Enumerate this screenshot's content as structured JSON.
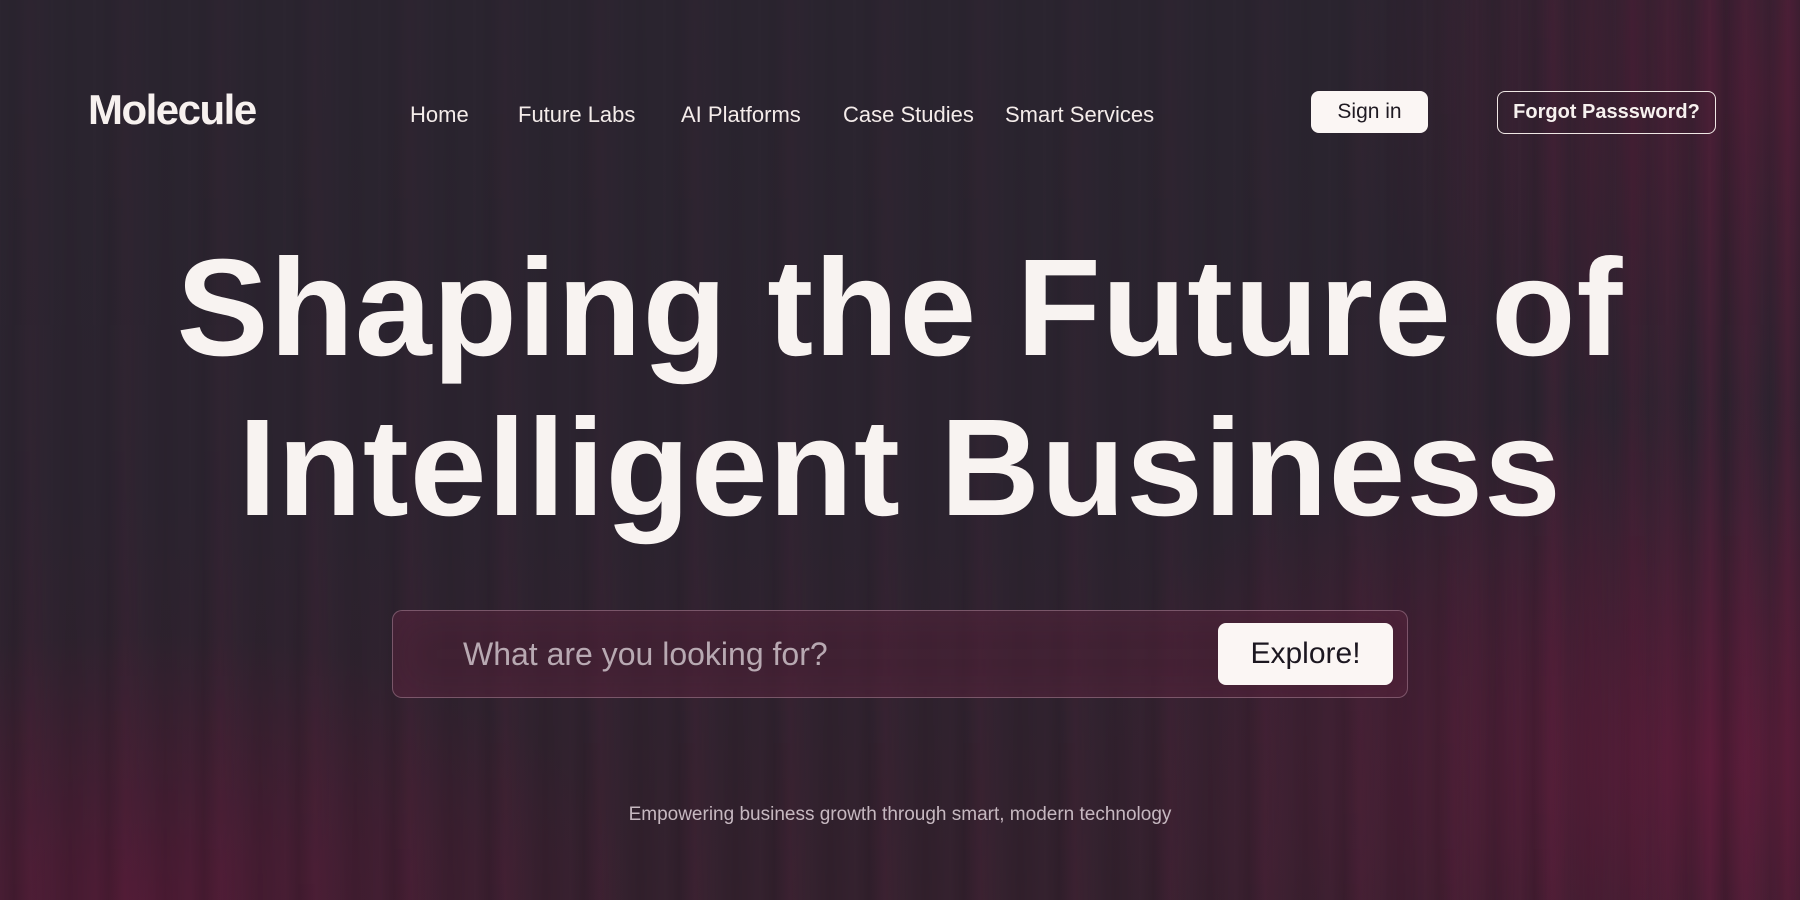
{
  "brand": {
    "name": "Molecule"
  },
  "nav": {
    "items": [
      {
        "label": "Home"
      },
      {
        "label": "Future Labs"
      },
      {
        "label": "AI Platforms"
      },
      {
        "label": "Case Studies"
      },
      {
        "label": "Smart Services"
      }
    ]
  },
  "auth": {
    "sign_in_label": "Sign in",
    "forgot_label": "Forgot Passsword?"
  },
  "hero": {
    "title_line1": "Shaping the Future of",
    "title_line2": "Intelligent Business"
  },
  "search": {
    "placeholder": "What are you looking for?",
    "value": "",
    "button_label": "Explore!"
  },
  "tagline": "Empowering business growth through smart, modern technology",
  "colors": {
    "background": "#2c2430",
    "accent_glow": "#5c1c3a",
    "text_primary": "#f7f1ef",
    "button_bg": "#fbf6f4",
    "button_text": "#1f1a22"
  }
}
